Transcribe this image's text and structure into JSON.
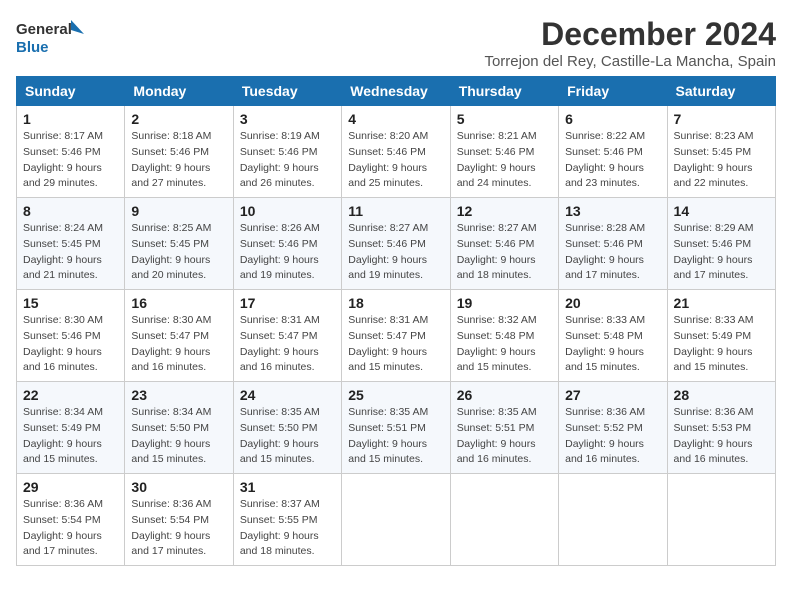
{
  "logo": {
    "line1": "General",
    "line2": "Blue"
  },
  "title": "December 2024",
  "subtitle": "Torrejon del Rey, Castille-La Mancha, Spain",
  "weekdays": [
    "Sunday",
    "Monday",
    "Tuesday",
    "Wednesday",
    "Thursday",
    "Friday",
    "Saturday"
  ],
  "weeks": [
    [
      {
        "day": "1",
        "info": "Sunrise: 8:17 AM\nSunset: 5:46 PM\nDaylight: 9 hours\nand 29 minutes."
      },
      {
        "day": "2",
        "info": "Sunrise: 8:18 AM\nSunset: 5:46 PM\nDaylight: 9 hours\nand 27 minutes."
      },
      {
        "day": "3",
        "info": "Sunrise: 8:19 AM\nSunset: 5:46 PM\nDaylight: 9 hours\nand 26 minutes."
      },
      {
        "day": "4",
        "info": "Sunrise: 8:20 AM\nSunset: 5:46 PM\nDaylight: 9 hours\nand 25 minutes."
      },
      {
        "day": "5",
        "info": "Sunrise: 8:21 AM\nSunset: 5:46 PM\nDaylight: 9 hours\nand 24 minutes."
      },
      {
        "day": "6",
        "info": "Sunrise: 8:22 AM\nSunset: 5:46 PM\nDaylight: 9 hours\nand 23 minutes."
      },
      {
        "day": "7",
        "info": "Sunrise: 8:23 AM\nSunset: 5:45 PM\nDaylight: 9 hours\nand 22 minutes."
      }
    ],
    [
      {
        "day": "8",
        "info": "Sunrise: 8:24 AM\nSunset: 5:45 PM\nDaylight: 9 hours\nand 21 minutes."
      },
      {
        "day": "9",
        "info": "Sunrise: 8:25 AM\nSunset: 5:45 PM\nDaylight: 9 hours\nand 20 minutes."
      },
      {
        "day": "10",
        "info": "Sunrise: 8:26 AM\nSunset: 5:46 PM\nDaylight: 9 hours\nand 19 minutes."
      },
      {
        "day": "11",
        "info": "Sunrise: 8:27 AM\nSunset: 5:46 PM\nDaylight: 9 hours\nand 19 minutes."
      },
      {
        "day": "12",
        "info": "Sunrise: 8:27 AM\nSunset: 5:46 PM\nDaylight: 9 hours\nand 18 minutes."
      },
      {
        "day": "13",
        "info": "Sunrise: 8:28 AM\nSunset: 5:46 PM\nDaylight: 9 hours\nand 17 minutes."
      },
      {
        "day": "14",
        "info": "Sunrise: 8:29 AM\nSunset: 5:46 PM\nDaylight: 9 hours\nand 17 minutes."
      }
    ],
    [
      {
        "day": "15",
        "info": "Sunrise: 8:30 AM\nSunset: 5:46 PM\nDaylight: 9 hours\nand 16 minutes."
      },
      {
        "day": "16",
        "info": "Sunrise: 8:30 AM\nSunset: 5:47 PM\nDaylight: 9 hours\nand 16 minutes."
      },
      {
        "day": "17",
        "info": "Sunrise: 8:31 AM\nSunset: 5:47 PM\nDaylight: 9 hours\nand 16 minutes."
      },
      {
        "day": "18",
        "info": "Sunrise: 8:31 AM\nSunset: 5:47 PM\nDaylight: 9 hours\nand 15 minutes."
      },
      {
        "day": "19",
        "info": "Sunrise: 8:32 AM\nSunset: 5:48 PM\nDaylight: 9 hours\nand 15 minutes."
      },
      {
        "day": "20",
        "info": "Sunrise: 8:33 AM\nSunset: 5:48 PM\nDaylight: 9 hours\nand 15 minutes."
      },
      {
        "day": "21",
        "info": "Sunrise: 8:33 AM\nSunset: 5:49 PM\nDaylight: 9 hours\nand 15 minutes."
      }
    ],
    [
      {
        "day": "22",
        "info": "Sunrise: 8:34 AM\nSunset: 5:49 PM\nDaylight: 9 hours\nand 15 minutes."
      },
      {
        "day": "23",
        "info": "Sunrise: 8:34 AM\nSunset: 5:50 PM\nDaylight: 9 hours\nand 15 minutes."
      },
      {
        "day": "24",
        "info": "Sunrise: 8:35 AM\nSunset: 5:50 PM\nDaylight: 9 hours\nand 15 minutes."
      },
      {
        "day": "25",
        "info": "Sunrise: 8:35 AM\nSunset: 5:51 PM\nDaylight: 9 hours\nand 15 minutes."
      },
      {
        "day": "26",
        "info": "Sunrise: 8:35 AM\nSunset: 5:51 PM\nDaylight: 9 hours\nand 16 minutes."
      },
      {
        "day": "27",
        "info": "Sunrise: 8:36 AM\nSunset: 5:52 PM\nDaylight: 9 hours\nand 16 minutes."
      },
      {
        "day": "28",
        "info": "Sunrise: 8:36 AM\nSunset: 5:53 PM\nDaylight: 9 hours\nand 16 minutes."
      }
    ],
    [
      {
        "day": "29",
        "info": "Sunrise: 8:36 AM\nSunset: 5:54 PM\nDaylight: 9 hours\nand 17 minutes."
      },
      {
        "day": "30",
        "info": "Sunrise: 8:36 AM\nSunset: 5:54 PM\nDaylight: 9 hours\nand 17 minutes."
      },
      {
        "day": "31",
        "info": "Sunrise: 8:37 AM\nSunset: 5:55 PM\nDaylight: 9 hours\nand 18 minutes."
      },
      {
        "day": "",
        "info": ""
      },
      {
        "day": "",
        "info": ""
      },
      {
        "day": "",
        "info": ""
      },
      {
        "day": "",
        "info": ""
      }
    ]
  ]
}
